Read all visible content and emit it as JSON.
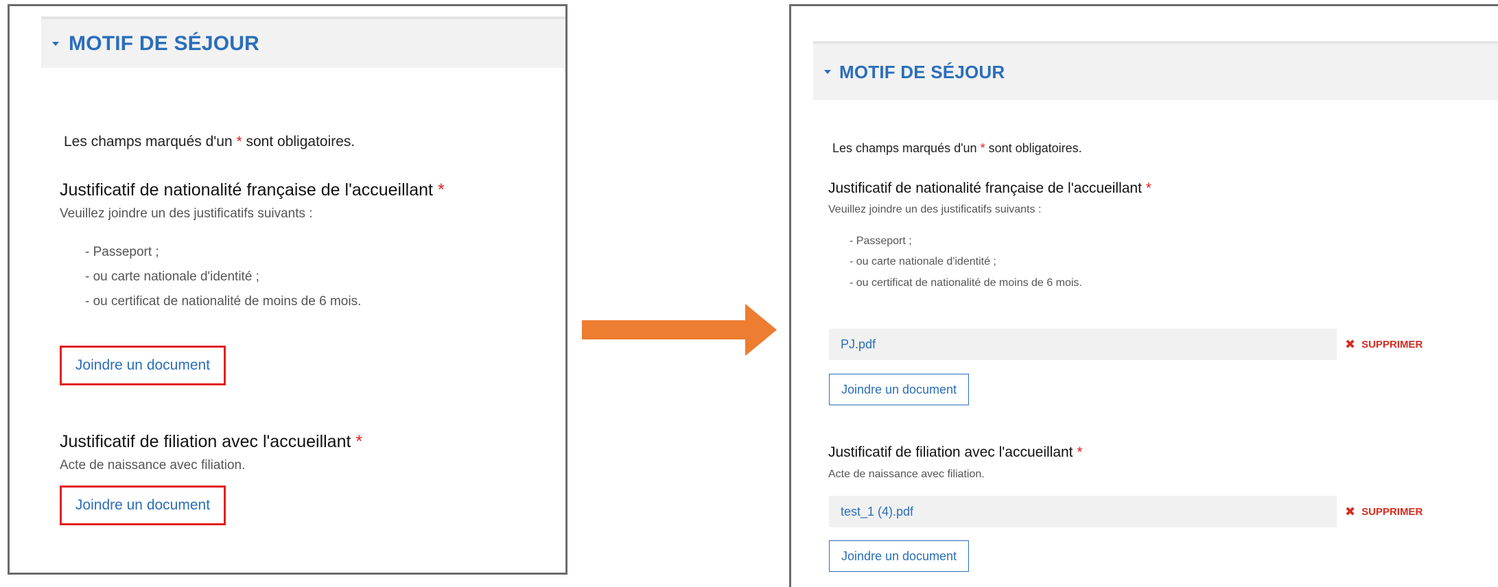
{
  "section_title": "MOTIF DE SÉJOUR",
  "required_note": {
    "prefix": "Les champs marqués d'un ",
    "star": "*",
    "suffix": " sont obligatoires."
  },
  "nationality": {
    "title": "Justificatif de nationalité française de l'accueillant",
    "star": "*",
    "hint": "Veuillez joindre un des justificatifs suivants :",
    "options": [
      "- Passeport ;",
      "- ou carte nationale d'identité ;",
      "- ou certificat de nationalité de moins de 6 mois."
    ]
  },
  "filiation": {
    "title": "Justificatif de filiation avec l'accueillant",
    "star": "*",
    "hint": "Acte de naissance avec filiation."
  },
  "join_label": "Joindre un document",
  "delete_label": "SUPPRIMER",
  "attached_files": {
    "nationality": "PJ.pdf",
    "filiation": "test_1 (4).pdf"
  },
  "colors": {
    "accent_blue": "#2a6ebb",
    "required_red": "#e0201b",
    "delete_red": "#d62b20",
    "highlight_red": "#e0201b",
    "arrow_orange": "#ed7d31",
    "header_bg": "#f2f2f2"
  },
  "icons": {
    "caret": "caret-down-icon",
    "delete": "close-x-icon",
    "arrow": "arrow-right-icon"
  }
}
